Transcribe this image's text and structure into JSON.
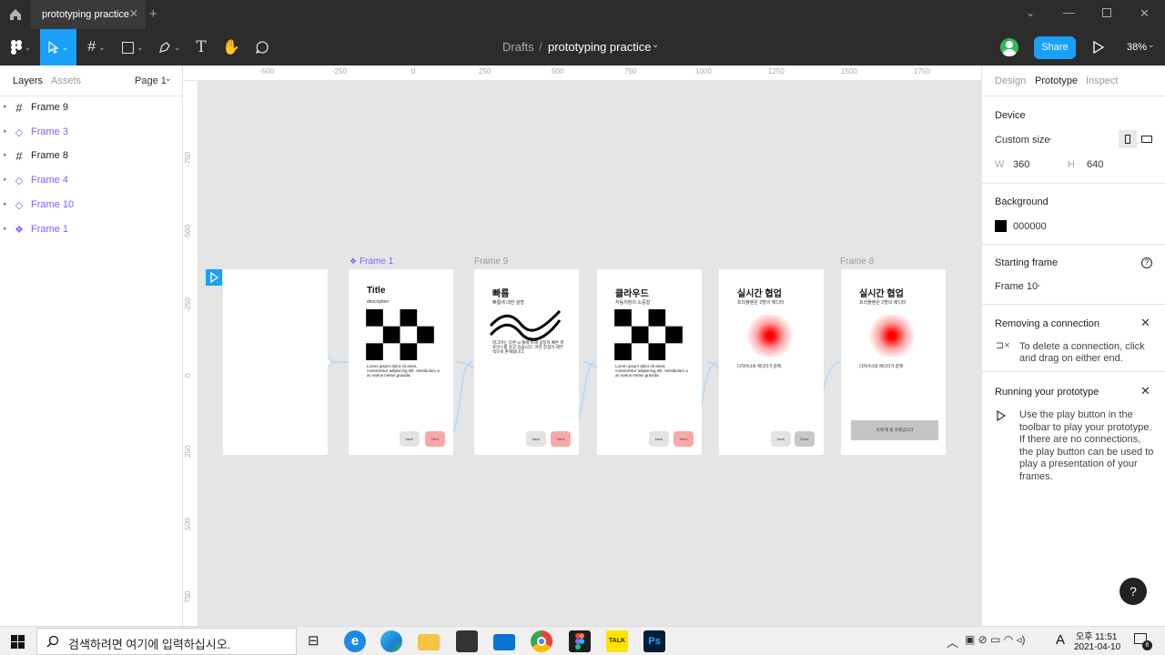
{
  "titlebar": {
    "tab_title": "prototyping practice"
  },
  "toolbar": {
    "breadcrumb_drafts": "Drafts",
    "breadcrumb_sep": "/",
    "file_name": "prototyping practice",
    "share": "Share",
    "zoom": "38%"
  },
  "left_panel": {
    "tab_layers": "Layers",
    "tab_assets": "Assets",
    "page": "Page 1",
    "layers": [
      {
        "name": "Frame 9",
        "color": "#222"
      },
      {
        "name": "Frame 3",
        "color": "#7b61ff"
      },
      {
        "name": "Frame 8",
        "color": "#222"
      },
      {
        "name": "Frame 4",
        "color": "#7b61ff"
      },
      {
        "name": "Frame 10",
        "color": "#7b61ff"
      },
      {
        "name": "Frame 1",
        "color": "#7b61ff"
      }
    ]
  },
  "ruler": {
    "x": [
      "-500",
      "-250",
      "0",
      "250",
      "500",
      "750",
      "1000",
      "1250",
      "1500",
      "1750"
    ],
    "y": [
      "-750",
      "-500",
      "-250",
      "0",
      "250",
      "500",
      "750"
    ]
  },
  "canvas": {
    "frame_labels": [
      "Frame 1",
      "Frame 9",
      "Frame 8"
    ],
    "frames": [
      {
        "title": "Title",
        "sub": "description",
        "para": "Lorem ipsum dolor sit amet, consectetur adipiscing elit. Vestibulum a ac varius metus gravida.",
        "back": "back",
        "next": "Next"
      },
      {
        "title": "빠름",
        "sub": "빠름에 대한 설명",
        "para": "피그마는 다른 ui 툴에 비해 굉장히 빠른 퍼포먼스를 갖고 있습니다. 어떤 장점이 세부적으로 존재합니다.",
        "back": "back",
        "next": "Next"
      },
      {
        "title": "클라우드",
        "sub": "자동저장의 소중함",
        "para": "Lorem ipsum dolor sit amet, consectetur adipiscing elit. Vestibulum a ac varius metus gravida.",
        "back": "back",
        "next": "Next"
      },
      {
        "title": "실시간 협업",
        "sub": "프리플랜은 2명의 에디터",
        "para": "디자이너와 에디터가 함께",
        "back": "back",
        "next": "Done"
      },
      {
        "title": "실시간 협업",
        "sub": "프리플랜은 2명의 에디터",
        "para": "디자이너와 에디터가 함께",
        "cta": "이제 해 볼 차례입니다"
      }
    ]
  },
  "right_panel": {
    "tab_design": "Design",
    "tab_prototype": "Prototype",
    "tab_inspect": "Inspect",
    "device_h": "Device",
    "device": "Custom size",
    "w_label": "W",
    "w": "360",
    "h_label": "H",
    "h": "640",
    "bg_h": "Background",
    "bg": "000000",
    "start_h": "Starting frame",
    "start": "Frame 10",
    "remove_h": "Removing a connection",
    "remove_text": "To delete a connection, click and drag on either end.",
    "run_h": "Running your prototype",
    "run_text": "Use the play button in the toolbar to play your prototype. If there are no connections, the play button can be used to play a presentation of your frames.",
    "help": "?"
  },
  "taskbar": {
    "search": "검색하려면 여기에 입력하십시오.",
    "ampm": "오후 11:51",
    "date": "2021-04-10",
    "lang": "A",
    "notif": "6",
    "talk": "TALK",
    "ps": "Ps"
  },
  "colors": {
    "accent": "#18a0fb",
    "proto": "#7b61ff",
    "connector": "#b9dbf7"
  }
}
